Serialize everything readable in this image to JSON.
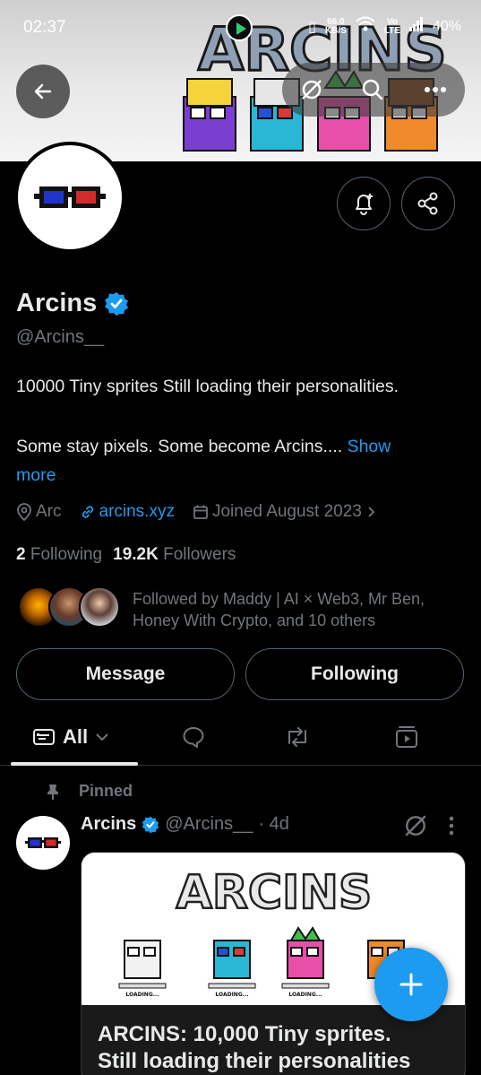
{
  "status_bar": {
    "time": "02:37",
    "speed_value": "66.0",
    "speed_unit": "KB/S",
    "volte_top": "Vo",
    "volte_bottom": "LTE",
    "battery": "40%"
  },
  "banner": {
    "art_text": "ARCINS"
  },
  "profile": {
    "name": "Arcins",
    "verified": true,
    "handle": "@Arcins__",
    "bio_line1": "10000 Tiny sprites Still loading their personalities.",
    "bio_line2": " Some stay pixels. Some become Arcins.... ",
    "bio_show": "Show",
    "bio_more": "more",
    "location": "Arc",
    "website": "arcins.xyz",
    "joined": "Joined August 2023",
    "following_count": "2",
    "following_label": "Following",
    "followers_count": "19.2K",
    "followers_label": "Followers",
    "followed_by_line1": "Followed by Maddy | AI × Web3, Mr Ben,",
    "followed_by_line2": "Honey With Crypto, and 10 others"
  },
  "actions": {
    "message": "Message",
    "following": "Following"
  },
  "tabs": {
    "all": "All"
  },
  "pinned_post": {
    "pinned_label": "Pinned",
    "author": "Arcins",
    "handle": "@Arcins__",
    "age": "· 4d",
    "card_art_text": "ARCINS",
    "card_loading": "LOADING...",
    "card_title_line1": "ARCINS: 10,000 Tiny sprites.",
    "card_title_line2": "Still loading their personalities"
  },
  "colors": {
    "accent": "#1d9bf0",
    "background": "#000000",
    "muted": "#71767b",
    "text": "#e7e9ea"
  }
}
